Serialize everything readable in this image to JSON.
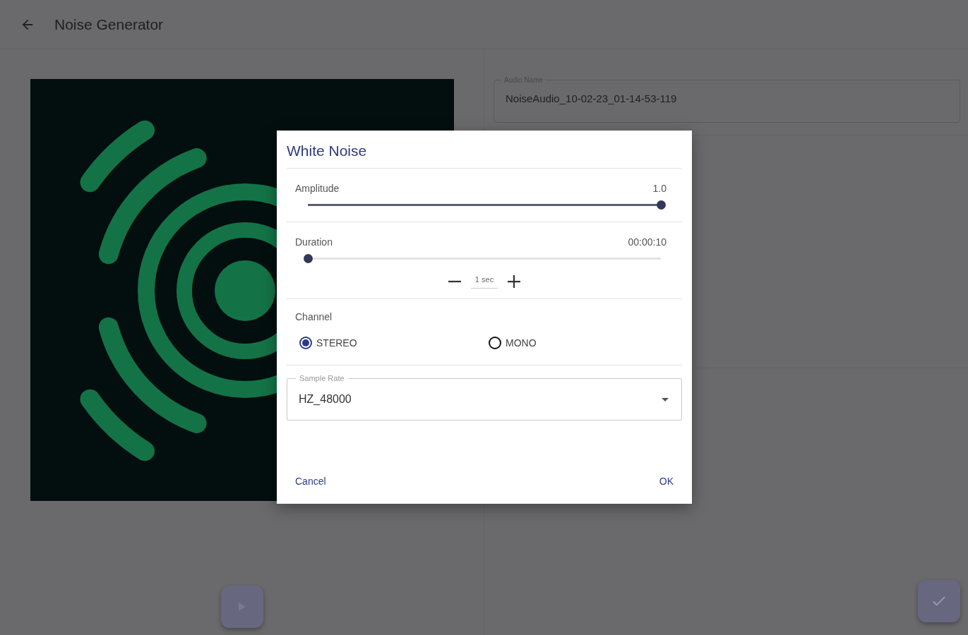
{
  "header": {
    "title": "Noise Generator"
  },
  "audio_name": {
    "label": "Audio Name",
    "value": "NoiseAudio_10-02-23_01-14-53-119"
  },
  "dialog": {
    "title": "White Noise",
    "sliders": [
      {
        "label": "Amplitude",
        "reading": "1.0",
        "level": 1
      },
      {
        "label": "Duration",
        "reading": "00:00:10",
        "level": 0
      }
    ],
    "step": {
      "value": "1 sec"
    },
    "channel": {
      "label": "Channel",
      "options": [
        {
          "label": "STEREO",
          "selected": true
        },
        {
          "label": "MONO",
          "selected": false
        }
      ]
    },
    "sample_rate": {
      "label": "Sample Rate",
      "value": "HZ_48000"
    },
    "buttons": [
      {
        "label": "Cancel"
      },
      {
        "label": "OK"
      }
    ]
  }
}
